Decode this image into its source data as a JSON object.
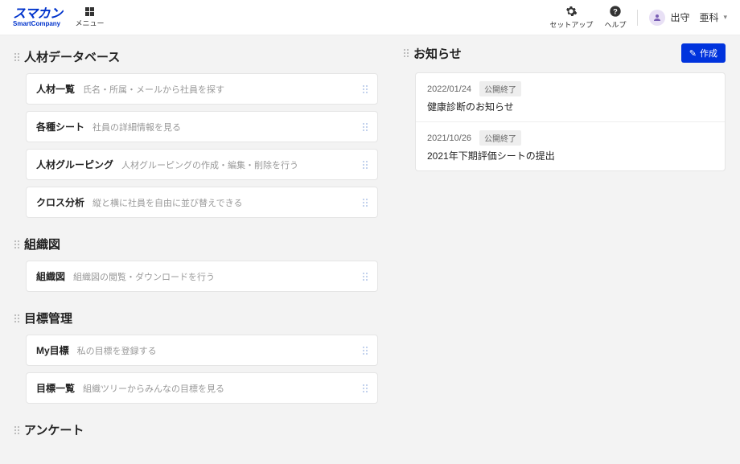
{
  "header": {
    "logo_main": "スマカン",
    "logo_sub": "SmartCompany",
    "menu_label": "メニュー",
    "setup_label": "セットアップ",
    "help_label": "ヘルプ",
    "user_name": "出守　亜科"
  },
  "sections": {
    "hr_db": {
      "title": "人材データベース",
      "items": [
        {
          "title": "人材一覧",
          "desc": "氏名・所属・メールから社員を探す"
        },
        {
          "title": "各種シート",
          "desc": "社員の詳細情報を見る"
        },
        {
          "title": "人材グルーピング",
          "desc": "人材グルーピングの作成・編集・削除を行う"
        },
        {
          "title": "クロス分析",
          "desc": "縦と横に社員を自由に並び替えできる"
        }
      ]
    },
    "org": {
      "title": "組織図",
      "items": [
        {
          "title": "組織図",
          "desc": "組織図の閲覧・ダウンロードを行う"
        }
      ]
    },
    "goals": {
      "title": "目標管理",
      "items": [
        {
          "title": "My目標",
          "desc": "私の目標を登録する"
        },
        {
          "title": "目標一覧",
          "desc": "組織ツリーからみんなの目標を見る"
        }
      ]
    },
    "survey": {
      "title": "アンケート"
    }
  },
  "notice": {
    "title": "お知らせ",
    "create_label": "作成",
    "items": [
      {
        "date": "2022/01/24",
        "badge": "公開終了",
        "text": "健康診断のお知らせ"
      },
      {
        "date": "2021/10/26",
        "badge": "公開終了",
        "text": "2021年下期評価シートの提出"
      }
    ]
  }
}
